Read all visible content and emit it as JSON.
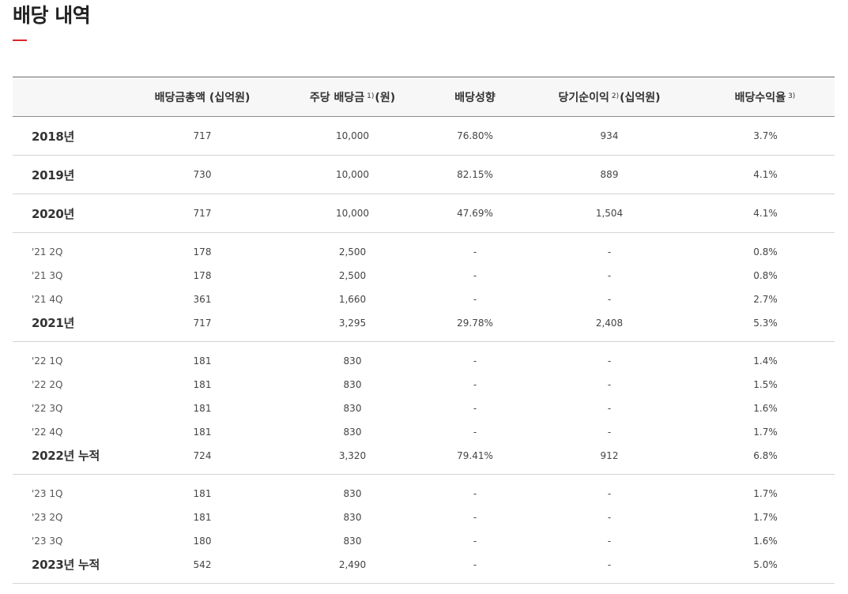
{
  "page": {
    "title": "배당 내역"
  },
  "table": {
    "headers": [
      {
        "label": "",
        "note": "",
        "suffix": ""
      },
      {
        "label": "배당금총액 (십억원)",
        "note": "",
        "suffix": ""
      },
      {
        "label": "주당 배당금",
        "note": "1)",
        "suffix": "(원)"
      },
      {
        "label": "배당성향",
        "note": "",
        "suffix": ""
      },
      {
        "label": "당기순이익",
        "note": "2)",
        "suffix": "(십억원)"
      },
      {
        "label": "배당수익율",
        "note": "3)",
        "suffix": ""
      }
    ],
    "groups": [
      {
        "rows": [
          {
            "label": "2018년",
            "total": "717",
            "per_share": "10,000",
            "payout": "76.80%",
            "net_income": "934",
            "yield": "3.7%"
          }
        ]
      },
      {
        "rows": [
          {
            "label": "2019년",
            "total": "730",
            "per_share": "10,000",
            "payout": "82.15%",
            "net_income": "889",
            "yield": "4.1%"
          }
        ]
      },
      {
        "rows": [
          {
            "label": "2020년",
            "total": "717",
            "per_share": "10,000",
            "payout": "47.69%",
            "net_income": "1,504",
            "yield": "4.1%"
          }
        ]
      },
      {
        "rows": [
          {
            "label": "'21 2Q",
            "total": "178",
            "per_share": "2,500",
            "payout": "-",
            "net_income": "-",
            "yield": "0.8%"
          },
          {
            "label": "'21 3Q",
            "total": "178",
            "per_share": "2,500",
            "payout": "-",
            "net_income": "-",
            "yield": "0.8%"
          },
          {
            "label": "'21 4Q",
            "total": "361",
            "per_share": "1,660",
            "payout": "-",
            "net_income": "-",
            "yield": "2.7%"
          },
          {
            "label": "2021년",
            "total": "717",
            "per_share": "3,295",
            "payout": "29.78%",
            "net_income": "2,408",
            "yield": "5.3%"
          }
        ]
      },
      {
        "rows": [
          {
            "label": "'22 1Q",
            "total": "181",
            "per_share": "830",
            "payout": "-",
            "net_income": "-",
            "yield": "1.4%"
          },
          {
            "label": "'22 2Q",
            "total": "181",
            "per_share": "830",
            "payout": "-",
            "net_income": "-",
            "yield": "1.5%"
          },
          {
            "label": "'22 3Q",
            "total": "181",
            "per_share": "830",
            "payout": "-",
            "net_income": "-",
            "yield": "1.6%"
          },
          {
            "label": "'22 4Q",
            "total": "181",
            "per_share": "830",
            "payout": "-",
            "net_income": "-",
            "yield": "1.7%"
          },
          {
            "label": "2022년 누적",
            "total": "724",
            "per_share": "3,320",
            "payout": "79.41%",
            "net_income": "912",
            "yield": "6.8%"
          }
        ]
      },
      {
        "rows": [
          {
            "label": "'23 1Q",
            "total": "181",
            "per_share": "830",
            "payout": "-",
            "net_income": "-",
            "yield": "1.7%"
          },
          {
            "label": "'23 2Q",
            "total": "181",
            "per_share": "830",
            "payout": "-",
            "net_income": "-",
            "yield": "1.7%"
          },
          {
            "label": "'23 3Q",
            "total": "180",
            "per_share": "830",
            "payout": "-",
            "net_income": "-",
            "yield": "1.6%"
          },
          {
            "label": "2023년 누적",
            "total": "542",
            "per_share": "2,490",
            "payout": "-",
            "net_income": "-",
            "yield": "5.0%"
          }
        ]
      }
    ]
  }
}
